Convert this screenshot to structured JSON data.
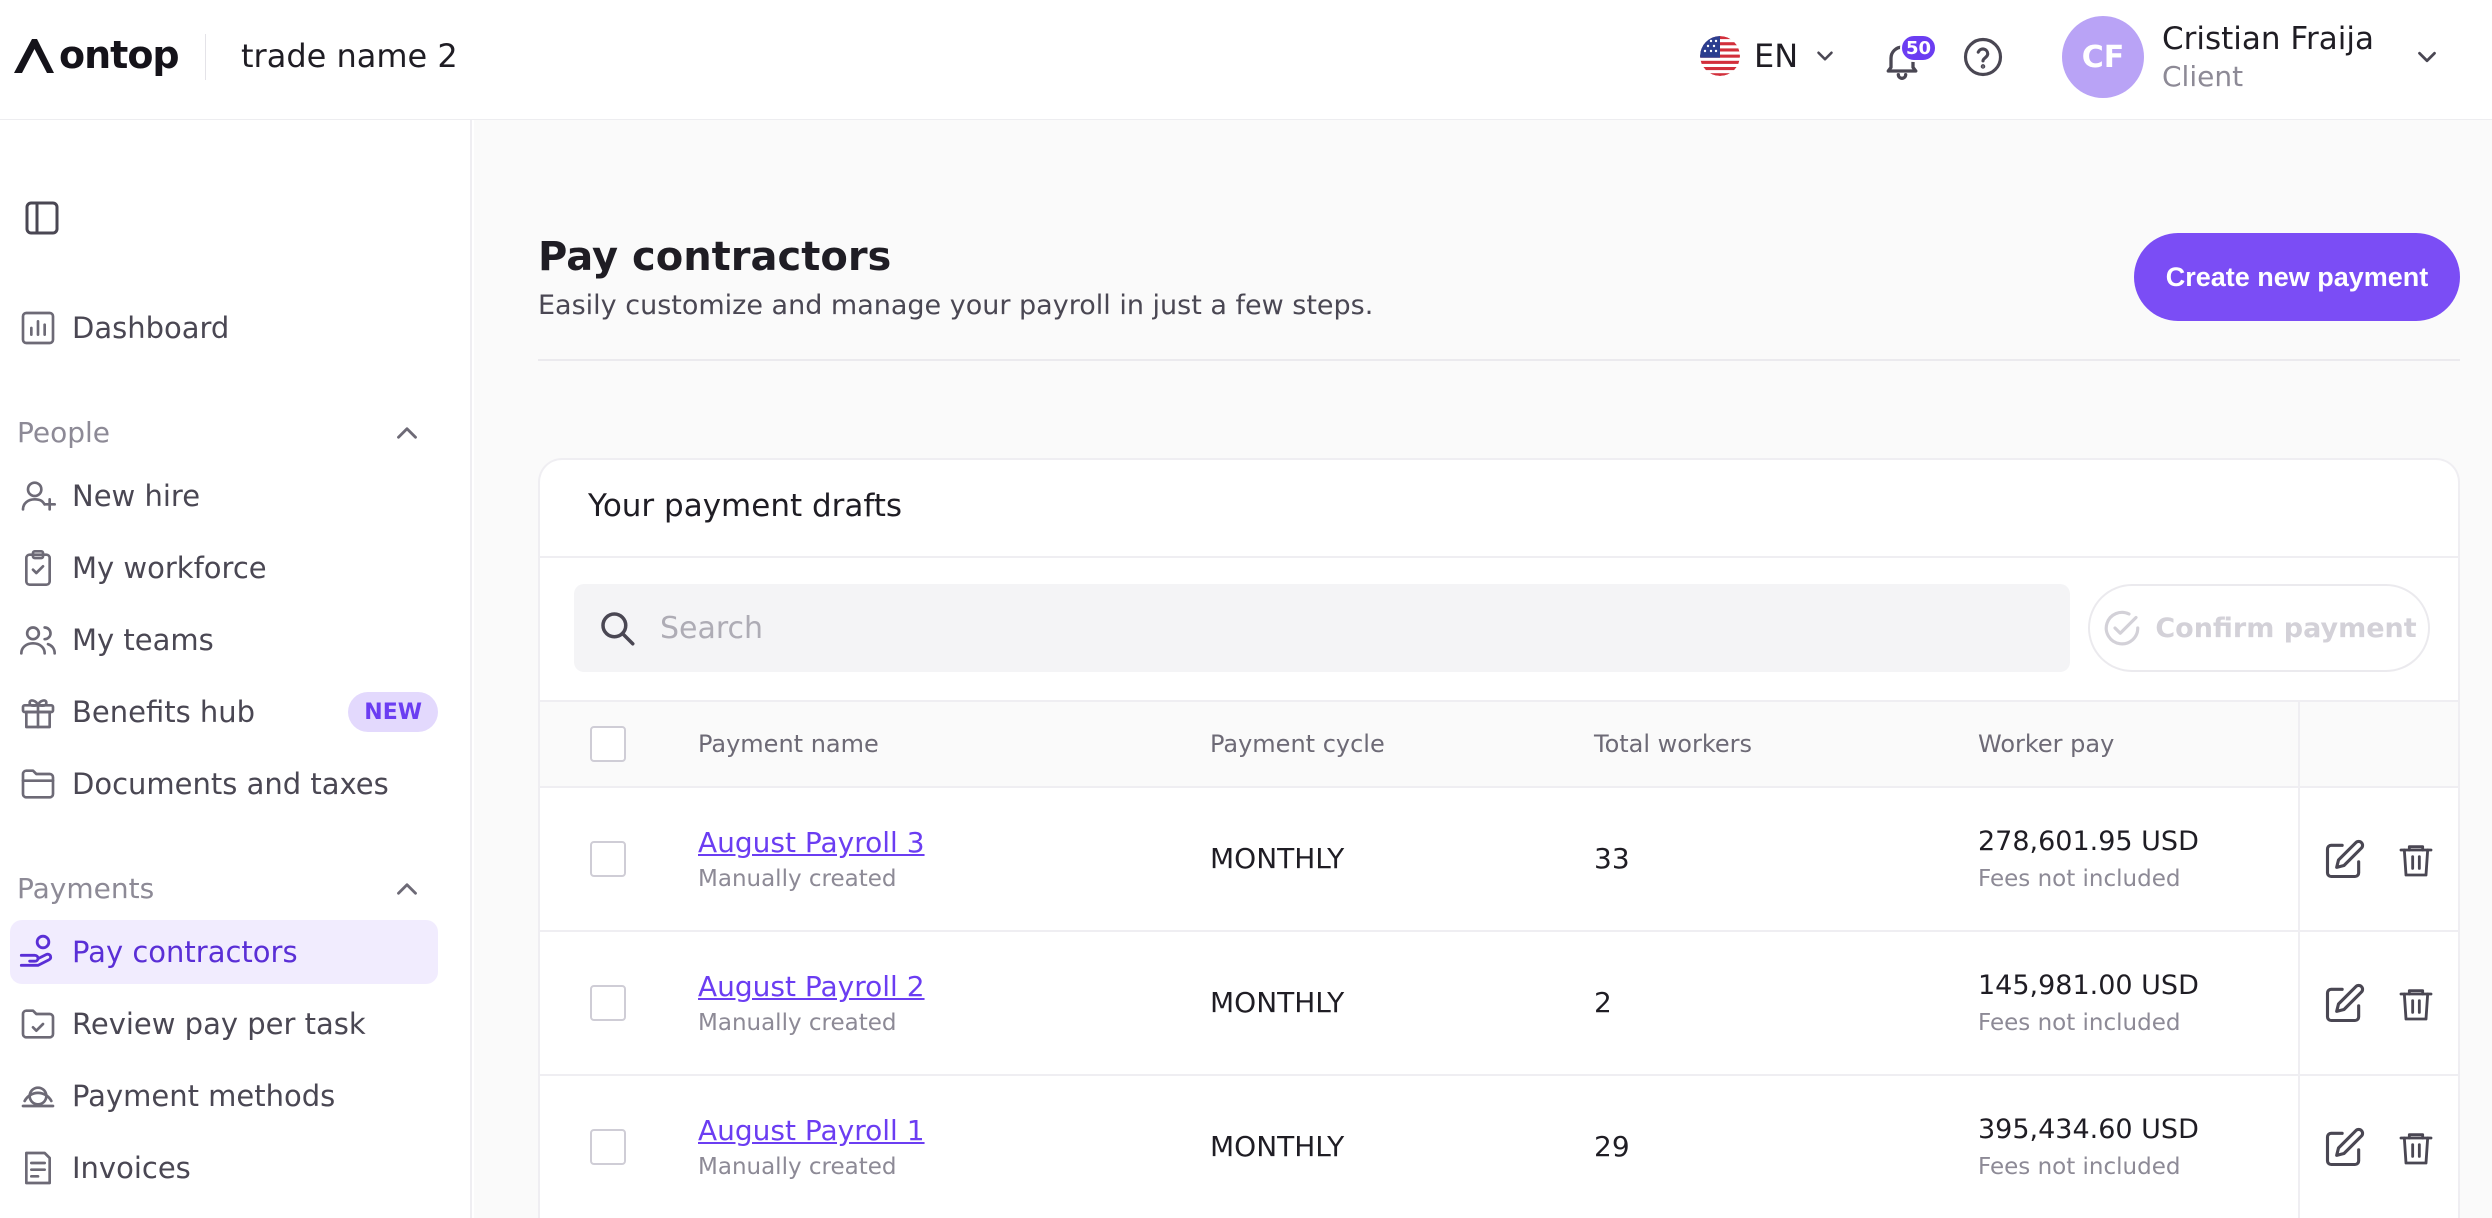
{
  "header": {
    "logo_text": "ontop",
    "trade_name": "trade name 2",
    "language": "EN",
    "notification_count": "50",
    "user": {
      "initials": "CF",
      "name": "Cristian Fraija",
      "role": "Client"
    }
  },
  "sidebar": {
    "dashboard": "Dashboard",
    "people_section": "People",
    "people_items": [
      {
        "label": "New hire",
        "icon": "user-plus-icon"
      },
      {
        "label": "My workforce",
        "icon": "clipboard-check-icon"
      },
      {
        "label": "My teams",
        "icon": "users-icon"
      },
      {
        "label": "Benefits hub",
        "icon": "gift-icon",
        "badge": "NEW"
      },
      {
        "label": "Documents and taxes",
        "icon": "folder-icon"
      }
    ],
    "payments_section": "Payments",
    "payments_items": [
      {
        "label": "Pay contractors",
        "icon": "hand-coins-icon",
        "active": true
      },
      {
        "label": "Review pay per task",
        "icon": "folder-check-icon"
      },
      {
        "label": "Payment methods",
        "icon": "payment-methods-icon"
      },
      {
        "label": "Invoices",
        "icon": "invoice-icon"
      }
    ]
  },
  "page": {
    "title": "Pay contractors",
    "subtitle": "Easily customize and manage your payroll in just a few steps.",
    "create_button": "Create new payment"
  },
  "drafts": {
    "title": "Your payment drafts",
    "search_placeholder": "Search",
    "confirm_button": "Confirm payment",
    "columns": [
      "Payment name",
      "Payment cycle",
      "Total workers",
      "Worker pay"
    ],
    "rows": [
      {
        "name": "August Payroll 3",
        "source": "Manually created",
        "cycle": "MONTHLY",
        "workers": "33",
        "pay": "278,601.95 USD",
        "fees": "Fees not included"
      },
      {
        "name": "August Payroll 2",
        "source": "Manually created",
        "cycle": "MONTHLY",
        "workers": "2",
        "pay": "145,981.00 USD",
        "fees": "Fees not included"
      },
      {
        "name": "August Payroll 1",
        "source": "Manually created",
        "cycle": "MONTHLY",
        "workers": "29",
        "pay": "395,434.60 USD",
        "fees": "Fees not included"
      }
    ]
  },
  "colors": {
    "accent": "#7b4df5",
    "link": "#6b3df2",
    "active_bg": "#f1ecfe",
    "badge_bg": "#e3d9fd",
    "avatar_bg": "#b9a3f6"
  }
}
